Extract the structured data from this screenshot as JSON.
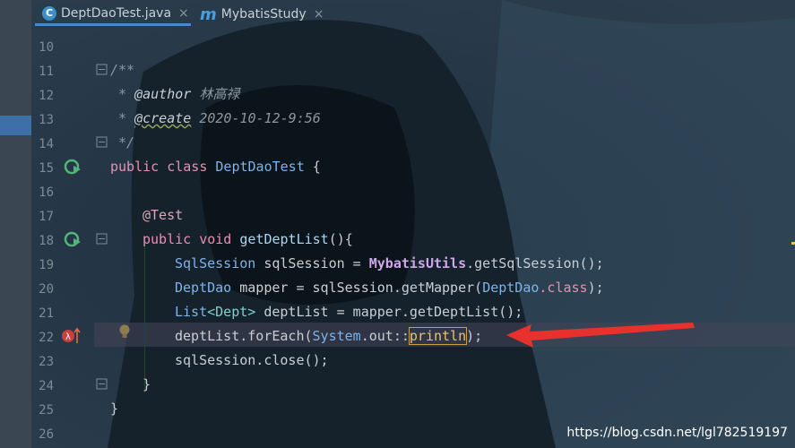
{
  "tabs": [
    {
      "label": "DeptDaoTest.java",
      "icon": "java-class-icon",
      "close": "×"
    },
    {
      "label": "MybatisStudy",
      "icon": "module-icon",
      "close": "×"
    }
  ],
  "line_numbers": [
    "10",
    "11",
    "12",
    "13",
    "14",
    "15",
    "16",
    "17",
    "18",
    "19",
    "20",
    "21",
    "22",
    "23",
    "24",
    "25",
    "26"
  ],
  "code": {
    "l11": "/**",
    "l12_prefix": " * ",
    "l12_tag": "@author",
    "l12_text": " 林高禄",
    "l13_prefix": " * ",
    "l13_tag": "@create",
    "l13_text": " 2020-10-12-9:56",
    "l14": " */",
    "l15_kw": "public class ",
    "l15_cls": "DeptDaoTest",
    "l15_rest": " {",
    "l17": "@Test",
    "l18_kw": "public void ",
    "l18_fn": "getDeptList",
    "l18_rest": "(){",
    "l19_type": "SqlSession",
    "l19_a": " sqlSession = ",
    "l19_util": "MybatisUtils",
    "l19_b": ".getSqlSession();",
    "l20_type": "DeptDao",
    "l20_a": " mapper = sqlSession.getMapper(",
    "l20_cls": "DeptDao",
    "l20_kw": ".class",
    "l20_b": ");",
    "l21_type": "List",
    "l21_gen": "<Dept>",
    "l21_a": " deptList = mapper.getDeptList();",
    "l22_a": "deptList.forEach(",
    "l22_sys": "System",
    "l22_b": ".out::",
    "l22_fn": "println",
    "l22_c": ");",
    "l23": "sqlSession.close();",
    "l24": "}",
    "l25": "}"
  },
  "watermark": "https://blog.csdn.net/lgl782519197",
  "colors": {
    "arrow": "#e8312c",
    "active_tab_underline": "#4a88c7"
  }
}
